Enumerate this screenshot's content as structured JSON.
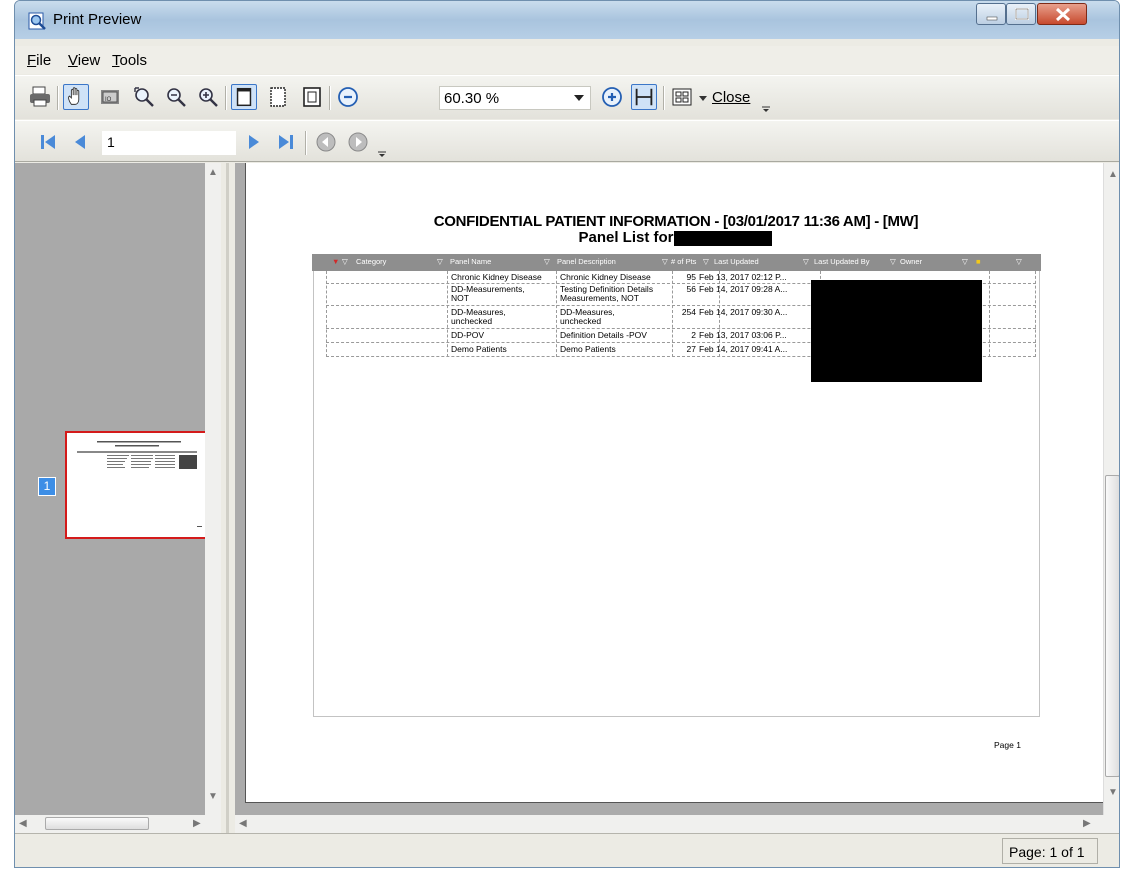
{
  "window": {
    "title": "Print Preview"
  },
  "menu": {
    "file": "ile",
    "file_key": "F",
    "view": "iew",
    "view_key": "V",
    "tools": "ools",
    "tools_key": "T"
  },
  "toolbar": {
    "zoom_value": "60.30 %",
    "close_key": "C",
    "close_rest": "lose"
  },
  "navbar": {
    "page_value": "1"
  },
  "thumbnail": {
    "page_number": "1"
  },
  "document": {
    "title_line1": "CONFIDENTIAL PATIENT INFORMATION - [03/01/2017 11:36 AM] - [MW]",
    "title_line2": "Panel List for",
    "columns": [
      "Category",
      "Panel Name",
      "Panel Description",
      "# of Pts",
      "Last Updated",
      "Last Updated By",
      "Owner"
    ],
    "rows": [
      {
        "panel_name": "Chronic Kidney Disease",
        "panel_name_2": "",
        "description": "Chronic Kidney Disease",
        "description_2": "",
        "pts": "95",
        "last_updated": "Feb 13, 2017 02:12 P..."
      },
      {
        "panel_name": "DD-Measurements,",
        "panel_name_2": "NOT",
        "description": "Testing Definition Details",
        "description_2": "Measurements, NOT",
        "pts": "56",
        "last_updated": "Feb 14, 2017 09:28 A..."
      },
      {
        "panel_name": "DD-Measures,",
        "panel_name_2": "unchecked",
        "description": "DD-Measures,",
        "description_2": "unchecked",
        "pts": "254",
        "last_updated": "Feb 14, 2017 09:30 A..."
      },
      {
        "panel_name": "DD-POV",
        "panel_name_2": "",
        "description": "Definition Details -POV",
        "description_2": "",
        "pts": "2",
        "last_updated": "Feb 13, 2017 03:06 P..."
      },
      {
        "panel_name": "Demo Patients",
        "panel_name_2": "",
        "description": "Demo Patients",
        "description_2": "",
        "pts": "27",
        "last_updated": "Feb 14, 2017 09:41 A..."
      }
    ],
    "footer": "Page 1"
  },
  "status": {
    "page_indicator": "Page: 1 of 1"
  },
  "colors": {
    "title_gradient": "#a9c4de",
    "selection": "#3b76c8",
    "thumb_border": "#d41a1a",
    "grid_header": "#8e8e8e",
    "workspace": "#ababab"
  }
}
